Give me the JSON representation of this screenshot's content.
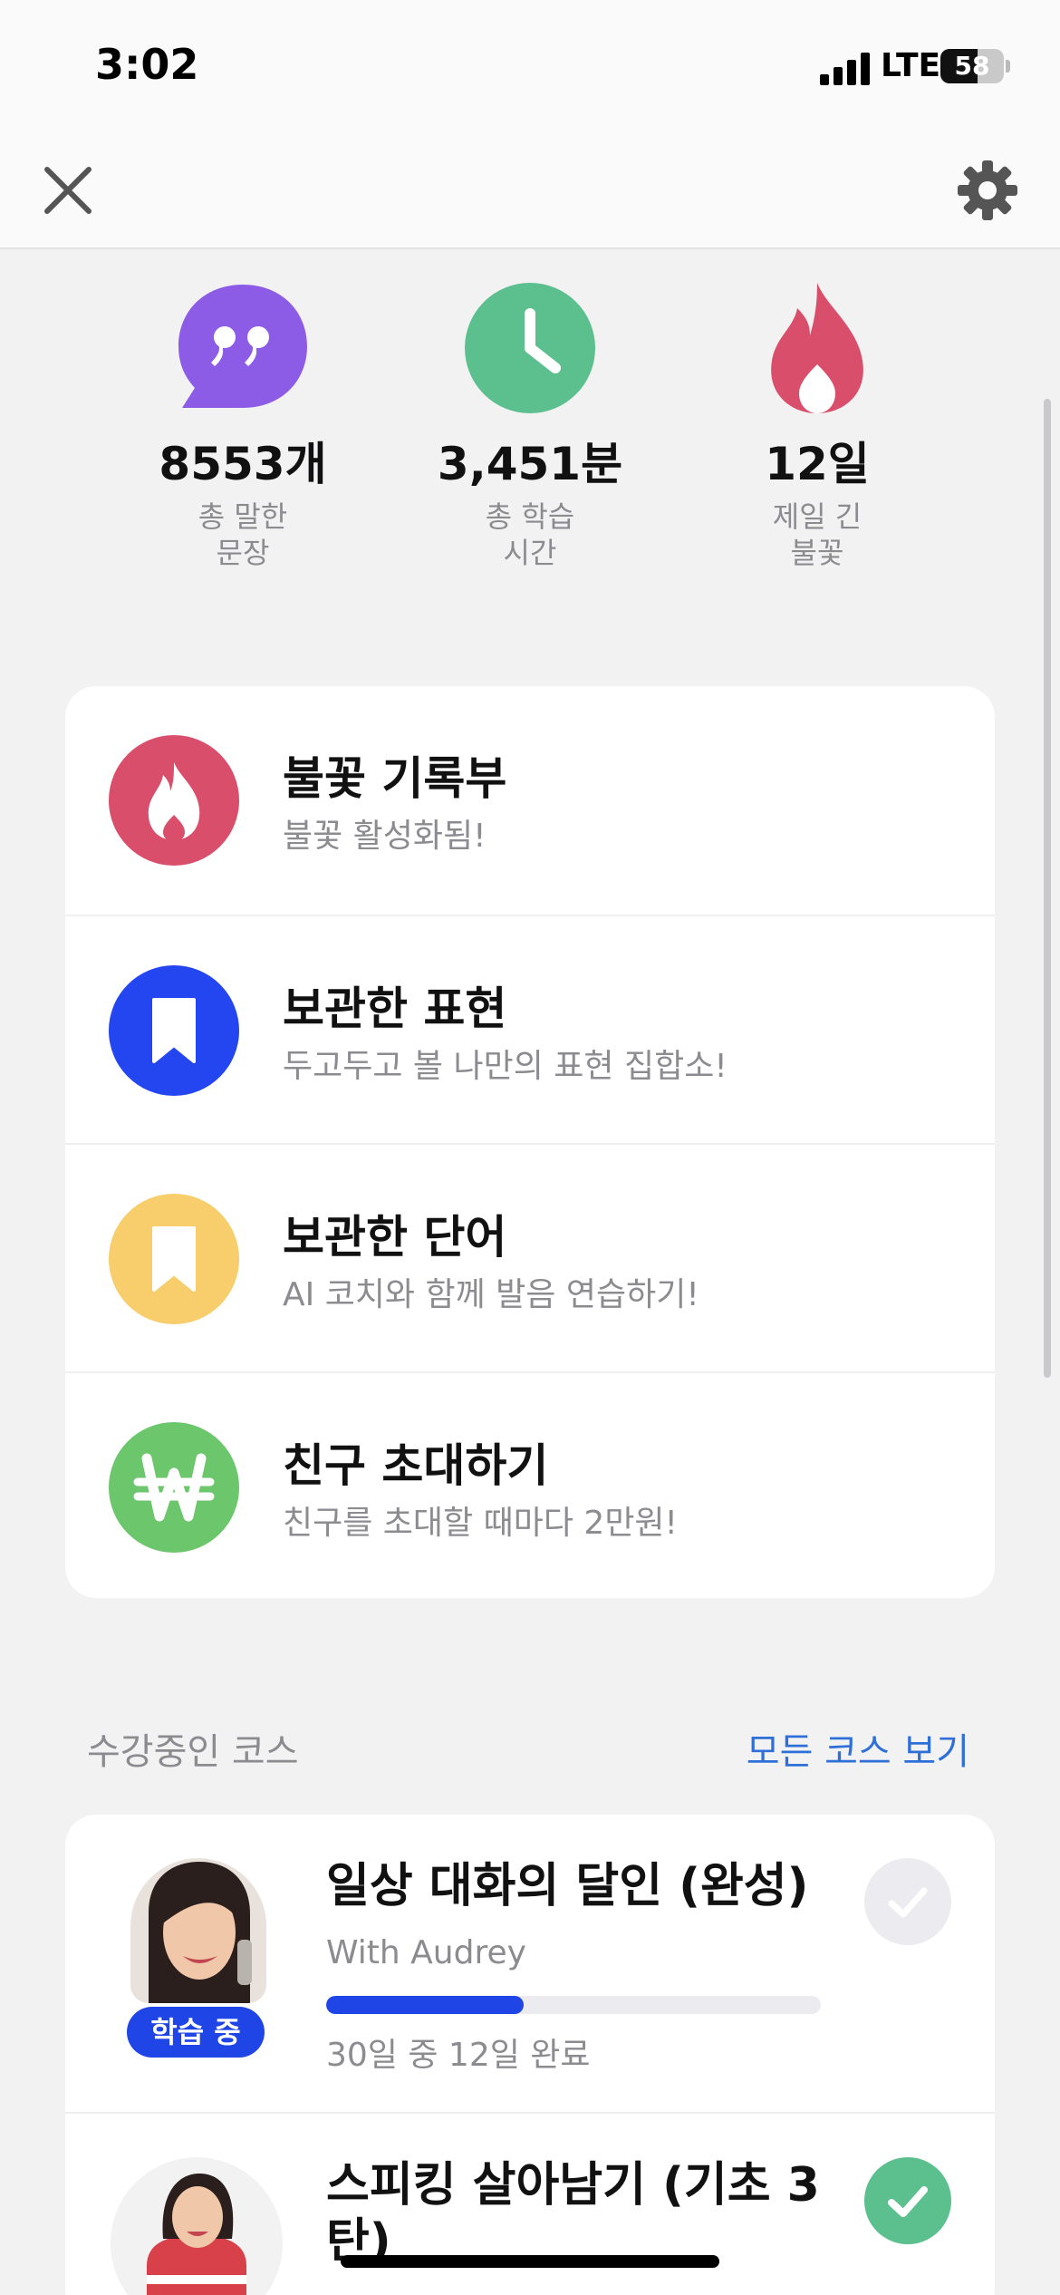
{
  "status_bar": {
    "time": "3:02",
    "network": "LTE",
    "battery": "58",
    "battery_level": 0.58
  },
  "icons": {
    "close": "close-icon",
    "settings": "gear-icon",
    "quote": "quote-bubble-icon",
    "clock": "clock-icon",
    "flame": "flame-icon",
    "bookmark": "bookmark-icon",
    "won": "won-icon",
    "check": "check-icon"
  },
  "colors": {
    "purple": "#8d5ce6",
    "green": "#5bbf8e",
    "red": "#d94f6b",
    "blue": "#2446f0",
    "yellow": "#f7ce6b",
    "lime": "#6cc66c",
    "accent": "#1f45e6",
    "link": "#2f6fd8",
    "check_inactive": "#ececf0",
    "check_active": "#5bbf8e"
  },
  "stats": [
    {
      "value": "8553개",
      "label": "총 말한\n문장"
    },
    {
      "value": "3,451분",
      "label": "총 학습\n시간"
    },
    {
      "value": "12일",
      "label": "제일 긴\n불꽃"
    }
  ],
  "menu": [
    {
      "title": "불꽃 기록부",
      "subtitle": "불꽃 활성화됨!"
    },
    {
      "title": "보관한 표현",
      "subtitle": "두고두고 볼 나만의 표현 집합소!"
    },
    {
      "title": "보관한 단어",
      "subtitle": "AI 코치와 함께 발음 연습하기!"
    },
    {
      "title": "친구 초대하기",
      "subtitle": "친구를 초대할 때마다 2만원!"
    }
  ],
  "courses_section": {
    "title": "수강중인 코스",
    "link": "모든 코스 보기"
  },
  "courses": [
    {
      "title": "일상 대화의 달인 (완성)",
      "teacher": "With Audrey",
      "badge": "학습 중",
      "progress_text": "30일 중 12일 완료",
      "progress": 0.4,
      "completed": false
    },
    {
      "title": "스피킹 살아남기 (기초 3탄)",
      "completed": true
    }
  ]
}
